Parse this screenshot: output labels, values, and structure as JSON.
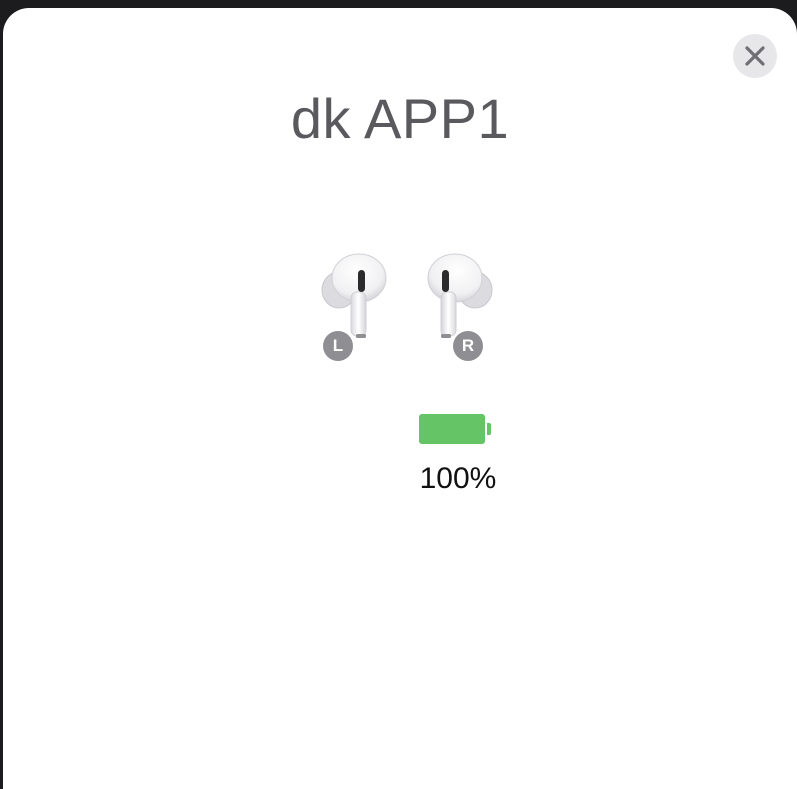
{
  "modal": {
    "device_name": "dk APP1",
    "close_icon": "close-icon",
    "earbuds": {
      "left_label": "L",
      "right_label": "R",
      "left_icon": "earbud-left-icon",
      "right_icon": "earbud-right-icon"
    },
    "battery": {
      "icon": "battery-full-icon",
      "level": 1.0,
      "percent_text": "100%",
      "color": "#64c466"
    }
  },
  "colors": {
    "sheet_background": "#ffffff",
    "backdrop": "#1c1c1e",
    "title_text": "#5a5a5e",
    "badge": "#8e8e93",
    "close_button_bg": "#e7e7ea"
  }
}
